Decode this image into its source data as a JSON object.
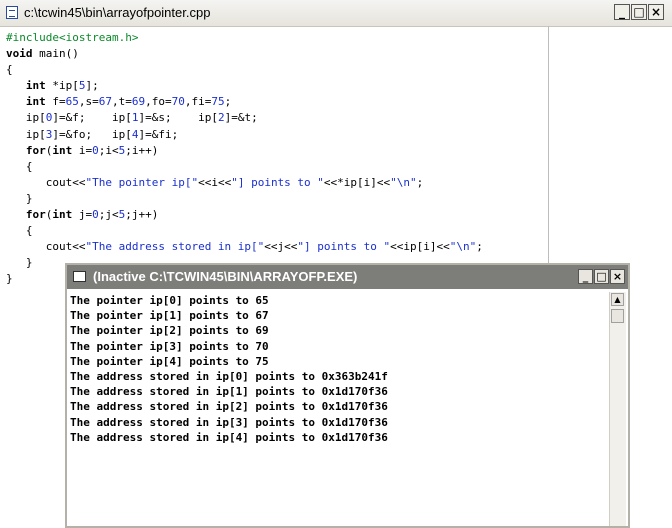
{
  "editor": {
    "title": "c:\\tcwin45\\bin\\arrayofpointer.cpp",
    "controls": {
      "minimize": "_",
      "maximize": "□",
      "close": "×"
    },
    "code_lines": [
      [
        {
          "t": "#include<iostream.h>",
          "c": "pp"
        }
      ],
      [
        {
          "t": "void",
          "c": "kw"
        },
        {
          "t": " main()"
        }
      ],
      [
        {
          "t": "{"
        }
      ],
      [
        {
          "t": "   "
        },
        {
          "t": "int",
          "c": "kw"
        },
        {
          "t": " *ip["
        },
        {
          "t": "5",
          "c": "num"
        },
        {
          "t": "];"
        }
      ],
      [
        {
          "t": "   "
        },
        {
          "t": "int",
          "c": "kw"
        },
        {
          "t": " f="
        },
        {
          "t": "65",
          "c": "num"
        },
        {
          "t": ",s="
        },
        {
          "t": "67",
          "c": "num"
        },
        {
          "t": ",t="
        },
        {
          "t": "69",
          "c": "num"
        },
        {
          "t": ",fo="
        },
        {
          "t": "70",
          "c": "num"
        },
        {
          "t": ",fi="
        },
        {
          "t": "75",
          "c": "num"
        },
        {
          "t": ";"
        }
      ],
      [
        {
          "t": "   ip["
        },
        {
          "t": "0",
          "c": "num"
        },
        {
          "t": "]=&f;    ip["
        },
        {
          "t": "1",
          "c": "num"
        },
        {
          "t": "]=&s;    ip["
        },
        {
          "t": "2",
          "c": "num"
        },
        {
          "t": "]=&t;"
        }
      ],
      [
        {
          "t": "   ip["
        },
        {
          "t": "3",
          "c": "num"
        },
        {
          "t": "]=&fo;   ip["
        },
        {
          "t": "4",
          "c": "num"
        },
        {
          "t": "]=&fi;"
        }
      ],
      [
        {
          "t": "   "
        },
        {
          "t": "for",
          "c": "kw"
        },
        {
          "t": "("
        },
        {
          "t": "int",
          "c": "kw"
        },
        {
          "t": " i="
        },
        {
          "t": "0",
          "c": "num"
        },
        {
          "t": ";i<"
        },
        {
          "t": "5",
          "c": "num"
        },
        {
          "t": ";i++)"
        }
      ],
      [
        {
          "t": "   {"
        }
      ],
      [
        {
          "t": "      cout<<"
        },
        {
          "t": "\"The pointer ip[\"",
          "c": "str"
        },
        {
          "t": "<<i<<"
        },
        {
          "t": "\"] points to \"",
          "c": "str"
        },
        {
          "t": "<<*ip[i]<<"
        },
        {
          "t": "\"\\n\"",
          "c": "str"
        },
        {
          "t": ";"
        }
      ],
      [
        {
          "t": "   }"
        }
      ],
      [
        {
          "t": "   "
        },
        {
          "t": "for",
          "c": "kw"
        },
        {
          "t": "("
        },
        {
          "t": "int",
          "c": "kw"
        },
        {
          "t": " j="
        },
        {
          "t": "0",
          "c": "num"
        },
        {
          "t": ";j<"
        },
        {
          "t": "5",
          "c": "num"
        },
        {
          "t": ";j++)"
        }
      ],
      [
        {
          "t": "   {"
        }
      ],
      [
        {
          "t": "      cout<<"
        },
        {
          "t": "\"The address stored in ip[\"",
          "c": "str"
        },
        {
          "t": "<<j<<"
        },
        {
          "t": "\"] points to \"",
          "c": "str"
        },
        {
          "t": "<<ip[i]<<"
        },
        {
          "t": "\"\\n\"",
          "c": "str"
        },
        {
          "t": ";"
        }
      ],
      [
        {
          "t": "   }"
        }
      ],
      [
        {
          "t": "}"
        }
      ]
    ]
  },
  "console": {
    "title": "(Inactive C:\\TCWIN45\\BIN\\ARRAYOFP.EXE)",
    "controls": {
      "minimize": "_",
      "maximize": "□",
      "close": "×"
    },
    "scroll_up": "▲",
    "output_lines": [
      "The pointer ip[0] points to 65",
      "The pointer ip[1] points to 67",
      "The pointer ip[2] points to 69",
      "The pointer ip[3] points to 70",
      "The pointer ip[4] points to 75",
      "The address stored in ip[0] points to 0x363b241f",
      "The address stored in ip[1] points to 0x1d170f36",
      "The address stored in ip[2] points to 0x1d170f36",
      "The address stored in ip[3] points to 0x1d170f36",
      "The address stored in ip[4] points to 0x1d170f36"
    ]
  }
}
